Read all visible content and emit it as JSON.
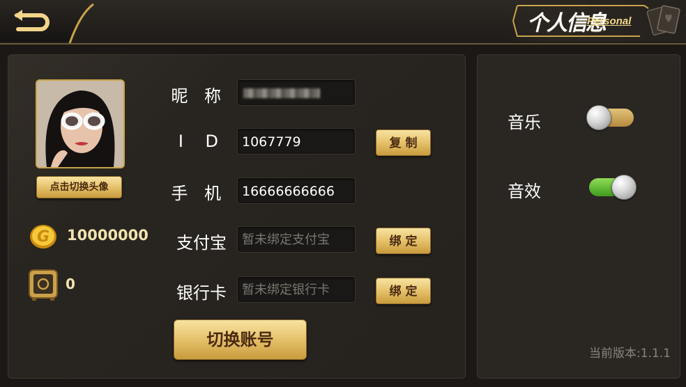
{
  "header": {
    "title_cn": "个人信息",
    "title_en": "Personal"
  },
  "profile": {
    "change_avatar_label": "点击切换头像",
    "coins": "10000000",
    "safe": "0"
  },
  "form": {
    "nickname_label": "昵 称",
    "id_label": "I D",
    "id_value": "1067779",
    "copy_label": "复制",
    "phone_label": "手 机",
    "phone_value": "16666666666",
    "alipay_label": "支付宝",
    "alipay_placeholder": "暂未绑定支付宝",
    "bind_alipay_label": "绑定",
    "bank_label": "银行卡",
    "bank_placeholder": "暂未绑定银行卡",
    "bind_bank_label": "绑定",
    "switch_account_label": "切换账号"
  },
  "settings": {
    "music_label": "音乐",
    "music_on": false,
    "effects_label": "音效",
    "effects_on": true,
    "version_text": "当前版本:1.1.1"
  },
  "colors": {
    "accent_gold": "#e8c570",
    "toggle_on": "#4faa27",
    "toggle_off": "#c99b3c",
    "background": "#1b1815"
  },
  "icons": {
    "back": "back-arrow-icon",
    "coin": "gold-coin-icon",
    "safe": "safe-box-icon",
    "cards": "playing-cards-icon"
  }
}
